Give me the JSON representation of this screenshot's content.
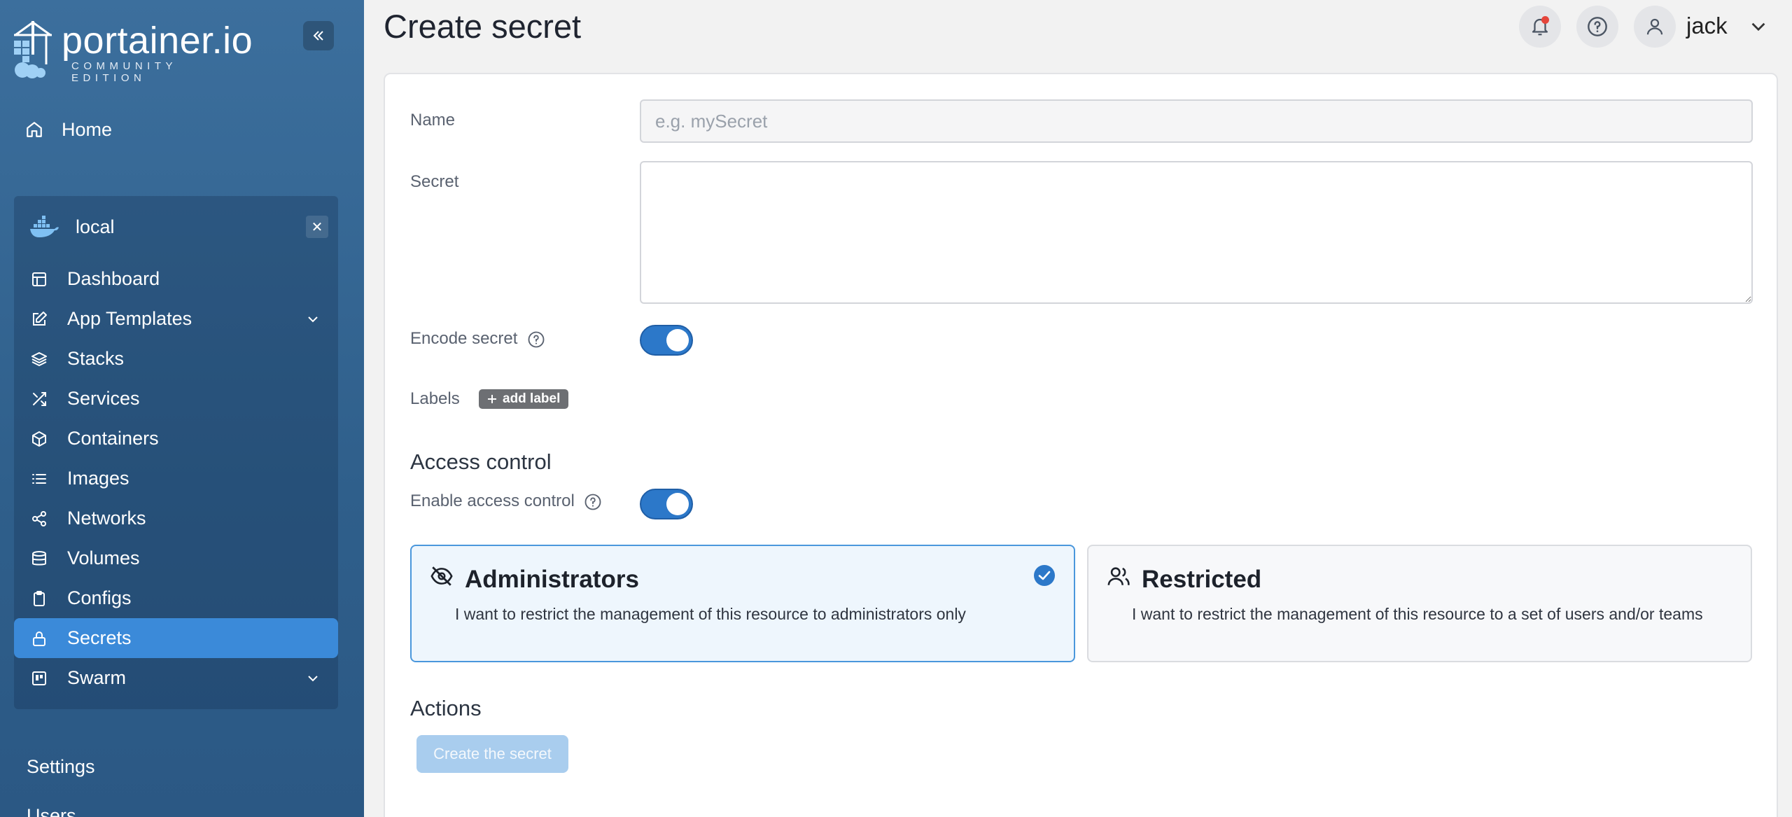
{
  "sidebar": {
    "brand_name": "portainer.io",
    "brand_edition": "COMMUNITY EDITION",
    "home_label": "Home",
    "environment": {
      "name": "local",
      "close_symbol": "✕"
    },
    "items": [
      {
        "label": "Dashboard",
        "icon": "dashboard-icon"
      },
      {
        "label": "App Templates",
        "icon": "edit-icon",
        "expandable": true
      },
      {
        "label": "Stacks",
        "icon": "layers-icon"
      },
      {
        "label": "Services",
        "icon": "shuffle-icon"
      },
      {
        "label": "Containers",
        "icon": "box-icon"
      },
      {
        "label": "Images",
        "icon": "list-icon"
      },
      {
        "label": "Networks",
        "icon": "share-icon"
      },
      {
        "label": "Volumes",
        "icon": "database-icon"
      },
      {
        "label": "Configs",
        "icon": "clipboard-icon"
      },
      {
        "label": "Secrets",
        "icon": "lock-icon",
        "active": true
      },
      {
        "label": "Swarm",
        "icon": "swarm-icon",
        "expandable": true
      }
    ],
    "settings_label": "Settings",
    "users_label": "Users"
  },
  "header": {
    "title": "Create secret",
    "user": "jack"
  },
  "form": {
    "name_label": "Name",
    "name_placeholder": "e.g. mySecret",
    "name_value": "",
    "secret_label": "Secret",
    "secret_value": "",
    "encode_label": "Encode secret",
    "encode_enabled": true,
    "labels_label": "Labels",
    "add_label": "add label"
  },
  "access_control": {
    "section_title": "Access control",
    "enable_label": "Enable access control",
    "enabled": true,
    "options": [
      {
        "title": "Administrators",
        "description": "I want to restrict the management of this resource to administrators only",
        "selected": true
      },
      {
        "title": "Restricted",
        "description": "I want to restrict the management of this resource to a set of users and/or teams",
        "selected": false
      }
    ]
  },
  "actions": {
    "section_title": "Actions",
    "create_label": "Create the secret"
  },
  "colors": {
    "sidebar_bg": "#336594",
    "active_item": "#3b8ad9",
    "accent": "#2c78c9",
    "selected_option_border": "#4a97dc",
    "notification_dot": "#e5453b"
  }
}
